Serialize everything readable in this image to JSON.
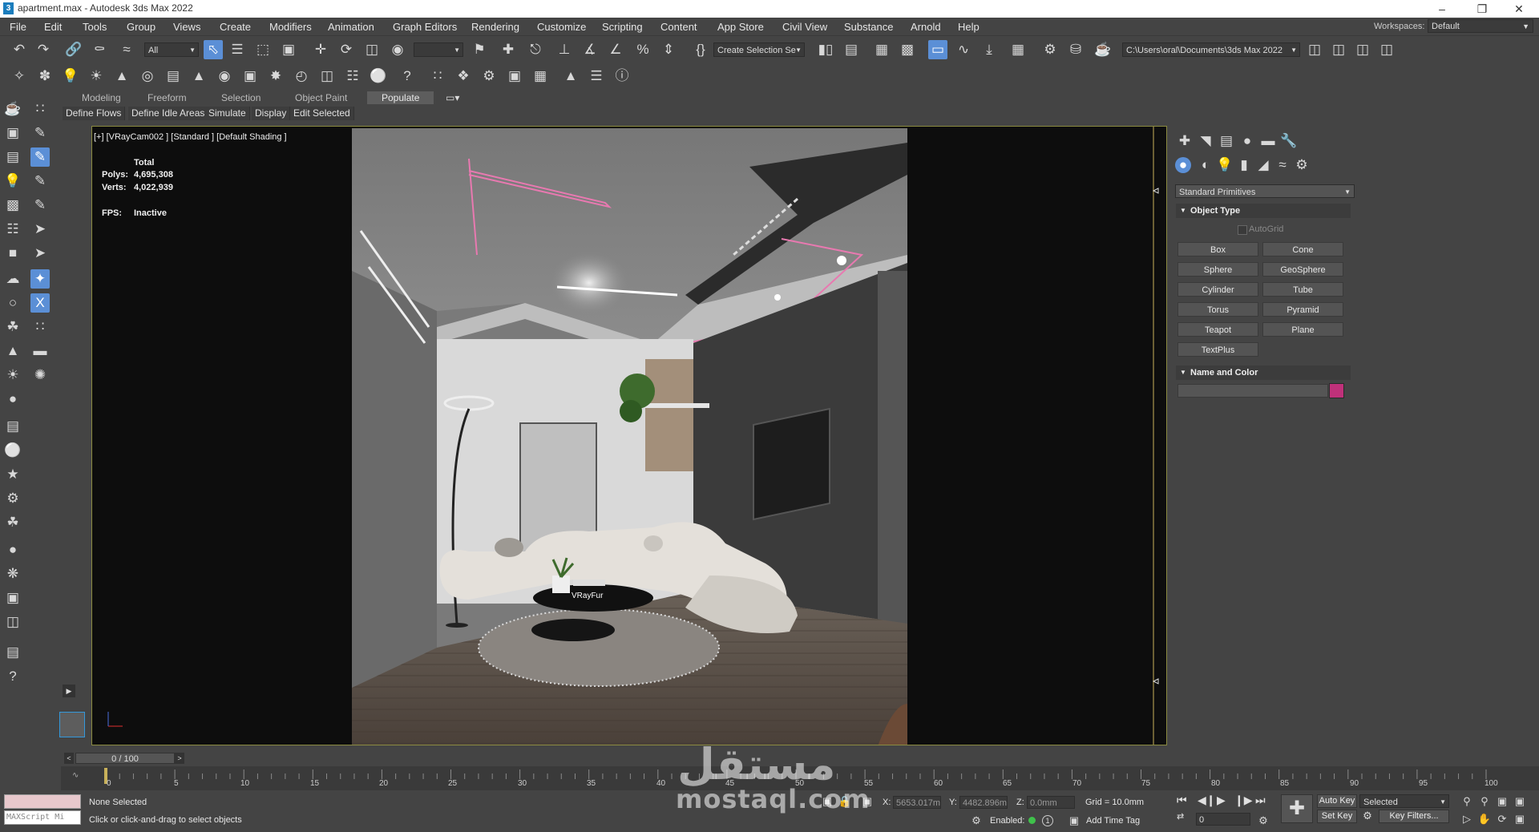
{
  "window": {
    "title": "apartment.max - Autodesk 3ds Max 2022",
    "app_icon": "3"
  },
  "menu": {
    "items": [
      "File",
      "Edit",
      "Tools",
      "Group",
      "Views",
      "Create",
      "Modifiers",
      "Animation",
      "Graph Editors",
      "Rendering",
      "Customize",
      "Scripting",
      "Content",
      "App Store",
      "Civil View",
      "Substance",
      "Arnold",
      "Help"
    ],
    "workspaces_label": "Workspaces:",
    "workspace_value": "Default"
  },
  "toolbar": {
    "selection_filter": "All",
    "named_selection": "Create Selection Se",
    "project_path": "C:\\Users\\oral\\Documents\\3ds Max 2022"
  },
  "ribbon": {
    "tabs": [
      "Modeling",
      "Freeform",
      "Selection",
      "Object Paint",
      "Populate"
    ],
    "active_tab": "Populate",
    "buttons": [
      "Define Flows",
      "Define Idle Areas",
      "Simulate",
      "Display",
      "Edit Selected"
    ]
  },
  "viewport": {
    "label": "[+] [VRayCam002 ] [Standard ] [Default Shading ]",
    "stats_total_label": "Total",
    "polys_label": "Polys:",
    "polys_value": "4,695,308",
    "verts_label": "Verts:",
    "verts_value": "4,022,939",
    "fps_label": "FPS:",
    "fps_value": "Inactive",
    "object_tag": "VRayFur"
  },
  "command_panel": {
    "category": "Standard Primitives",
    "object_type_title": "Object Type",
    "autogrid_label": "AutoGrid",
    "buttons": [
      "Box",
      "Cone",
      "Sphere",
      "GeoSphere",
      "Cylinder",
      "Tube",
      "Torus",
      "Pyramid",
      "Teapot",
      "Plane",
      "TextPlus"
    ],
    "name_color_title": "Name and Color",
    "object_color": "#c0317a"
  },
  "timeline": {
    "frame_counter": "0 / 100",
    "ticks": [
      "0",
      "5",
      "10",
      "15",
      "20",
      "25",
      "30",
      "35",
      "40",
      "45",
      "50",
      "55",
      "60",
      "65",
      "70",
      "75",
      "80",
      "85",
      "90",
      "95",
      "100"
    ]
  },
  "status": {
    "maxscript_label": "MAXScript Mi",
    "selection_status": "None Selected",
    "prompt": "Click or click-and-drag to select objects",
    "x_label": "X:",
    "x_value": "5653.017m",
    "y_label": "Y:",
    "y_value": "4482.896m",
    "z_label": "Z:",
    "z_value": "0.0mm",
    "grid": "Grid = 10.0mm",
    "enabled_label": "Enabled:",
    "add_time_tag": "Add Time Tag",
    "auto_key": "Auto Key",
    "set_key": "Set Key",
    "key_mode": "Selected",
    "key_filters": "Key Filters...",
    "current_frame": "0"
  },
  "watermark": {
    "arabic": "مستقل",
    "latin": "mostaql.com"
  }
}
